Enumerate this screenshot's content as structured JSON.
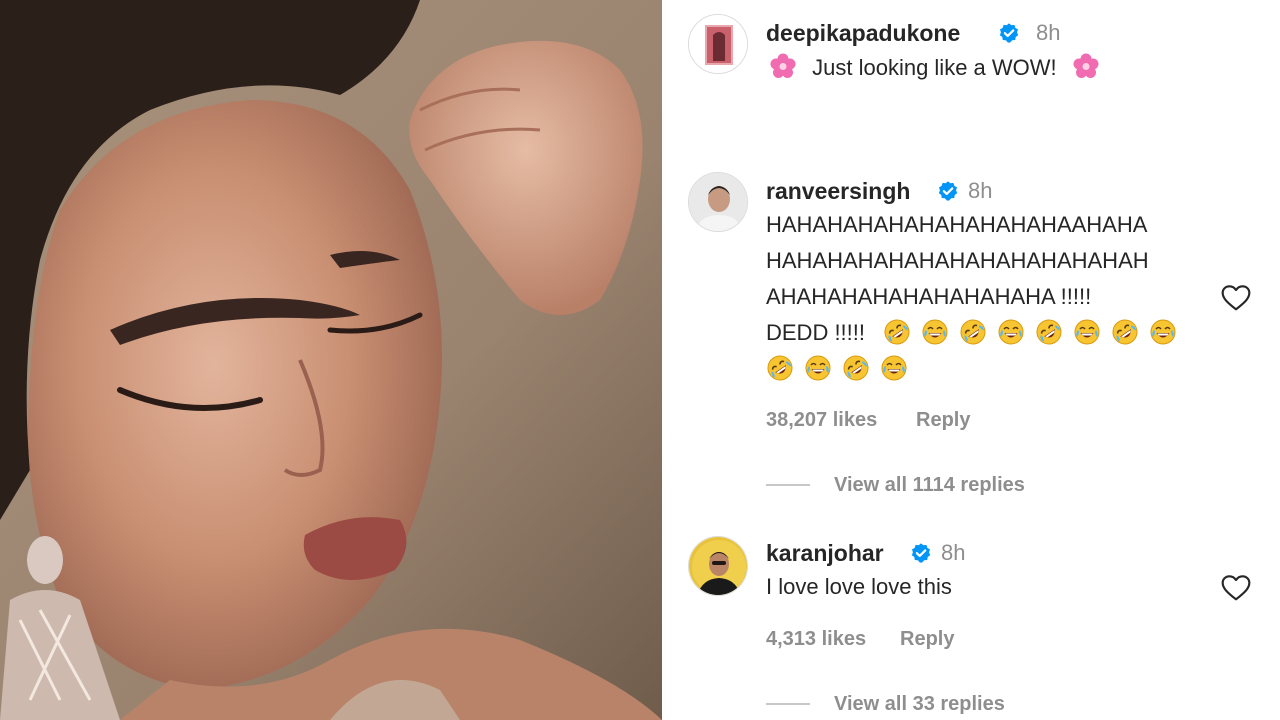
{
  "caption": {
    "username": "deepikapadukone",
    "time": "8h",
    "text": "Just looking like a WOW!",
    "decor_icon": "pink-flower-icon"
  },
  "comments": [
    {
      "username": "ranveersingh",
      "time": "8h",
      "lines": [
        "HAHAHAHAHAHAHAHAHAHAAHAHA",
        "HAHAHAHAHAHAHAHAHAHAHAHAH",
        "AHAHAHAHAHAHAHAHAHA !!!!!",
        "DEDD !!!!!"
      ],
      "emoji_line_1": [
        "rofl",
        "joy",
        "rofl",
        "joy",
        "rofl",
        "joy",
        "rofl",
        "joy"
      ],
      "emoji_line_2": [
        "rofl",
        "joy",
        "rofl",
        "joy"
      ],
      "likes": "38,207 likes",
      "reply_label": "Reply",
      "view_replies": "View all 1114 replies"
    },
    {
      "username": "karanjohar",
      "time": "8h",
      "lines": [
        "I love love love this"
      ],
      "likes": "4,313 likes",
      "reply_label": "Reply",
      "view_replies": "View all 33 replies"
    }
  ],
  "colors": {
    "text": "#262626",
    "secondary": "#8e8e8e",
    "verified": "#0095f6",
    "flower": "#f06bb0"
  }
}
